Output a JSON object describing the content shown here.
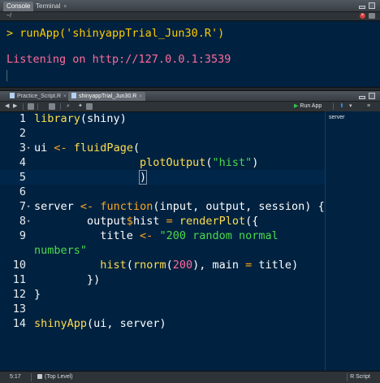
{
  "console": {
    "tabs": [
      {
        "label": "Console",
        "active": true
      },
      {
        "label": "Terminal",
        "active": false
      }
    ],
    "terminal_close": "×",
    "path": "~/",
    "lines": {
      "command": "> runApp('shinyappTrial_Jun30.R')",
      "output": "Listening on http://127.0.0.1:3539"
    },
    "icons": [
      "clear-console-icon",
      "minimize-icon",
      "maximize-icon"
    ]
  },
  "editor": {
    "tabs": [
      {
        "label": "Practice_Script.R",
        "active": false
      },
      {
        "label": "shinyappTrial_Jun30.R",
        "active": true
      }
    ],
    "close_glyph": "×",
    "toolbar": {
      "run_app_label": "Run App",
      "icons": [
        "back-arrow-icon",
        "forward-arrow-icon",
        "source-icon",
        "save-icon",
        "search-icon",
        "wand-icon",
        "publish-icon",
        "options-icon"
      ]
    },
    "side_panel_label": "server",
    "code": [
      {
        "n": "1",
        "text": "library(shiny)"
      },
      {
        "n": "2",
        "text": ""
      },
      {
        "n": "3",
        "text": "ui <- fluidPage("
      },
      {
        "n": "4",
        "text": "                plotOutput(\"hist\")"
      },
      {
        "n": "5",
        "text": "                )"
      },
      {
        "n": "6",
        "text": ""
      },
      {
        "n": "7",
        "text": "server <- function(input, output, session) {"
      },
      {
        "n": "8",
        "text": "        output$hist = renderPlot({"
      },
      {
        "n": "9",
        "text": "          title <- \"200 random normal"
      },
      {
        "n": "",
        "text": "numbers\""
      },
      {
        "n": "10",
        "text": "          hist(rnorm(200), main = title)"
      },
      {
        "n": "11",
        "text": "        })"
      },
      {
        "n": "12",
        "text": "}"
      },
      {
        "n": "13",
        "text": ""
      },
      {
        "n": "14",
        "text": "shinyApp(ui, server)"
      }
    ],
    "current_line": "5",
    "fold_markers": [
      "3",
      "7",
      "8"
    ]
  },
  "status": {
    "cursor": "5:17",
    "scope": "(Top Level)",
    "language": "R Script"
  },
  "colors": {
    "background": "#002240",
    "prompt": "#ffcc00",
    "output": "#ff6b9d",
    "keyword": "#ffa61e",
    "function": "#ffde4f",
    "string": "#4dd84d",
    "number": "#ff6b9d"
  }
}
